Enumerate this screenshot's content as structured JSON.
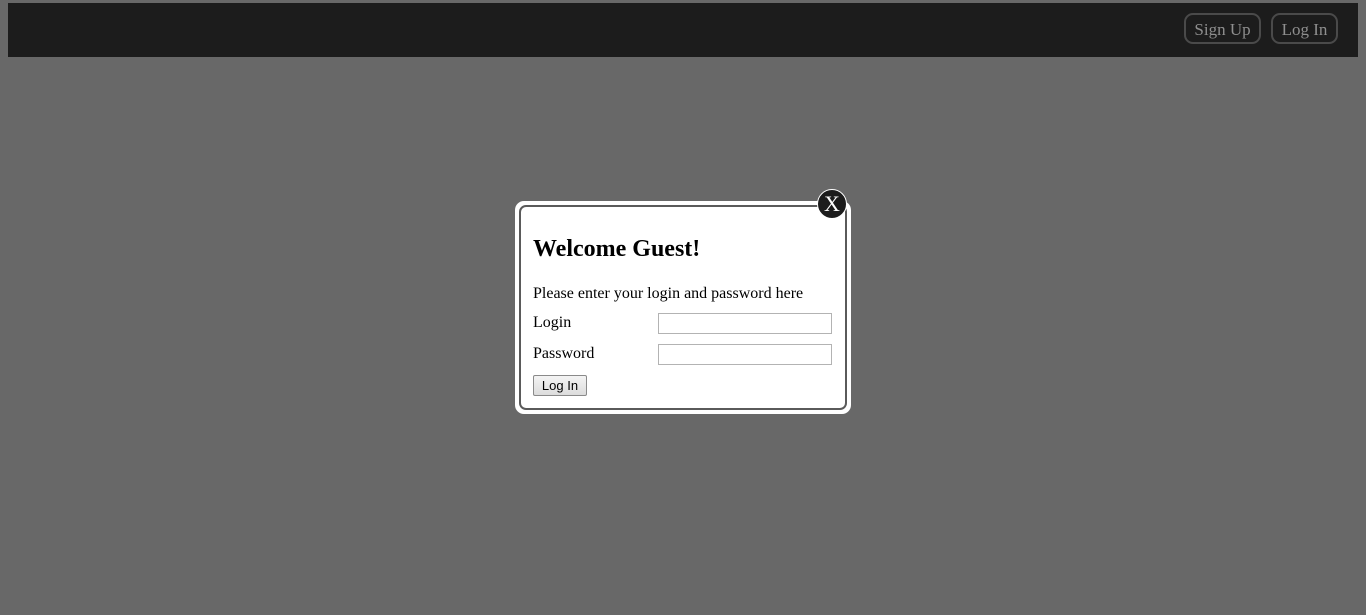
{
  "header": {
    "signup_label": "Sign Up",
    "login_label": "Log In"
  },
  "modal": {
    "close_label": "X",
    "title": "Welcome Guest!",
    "description": "Please enter your login and password here",
    "login_label": "Login",
    "login_value": "",
    "password_label": "Password",
    "password_value": "",
    "submit_label": "Log In"
  },
  "colors": {
    "overlay": "#686868",
    "topbar": "#1c1c1c",
    "nav_button_text": "#8f8f8f",
    "modal_background": "#ffffff"
  }
}
